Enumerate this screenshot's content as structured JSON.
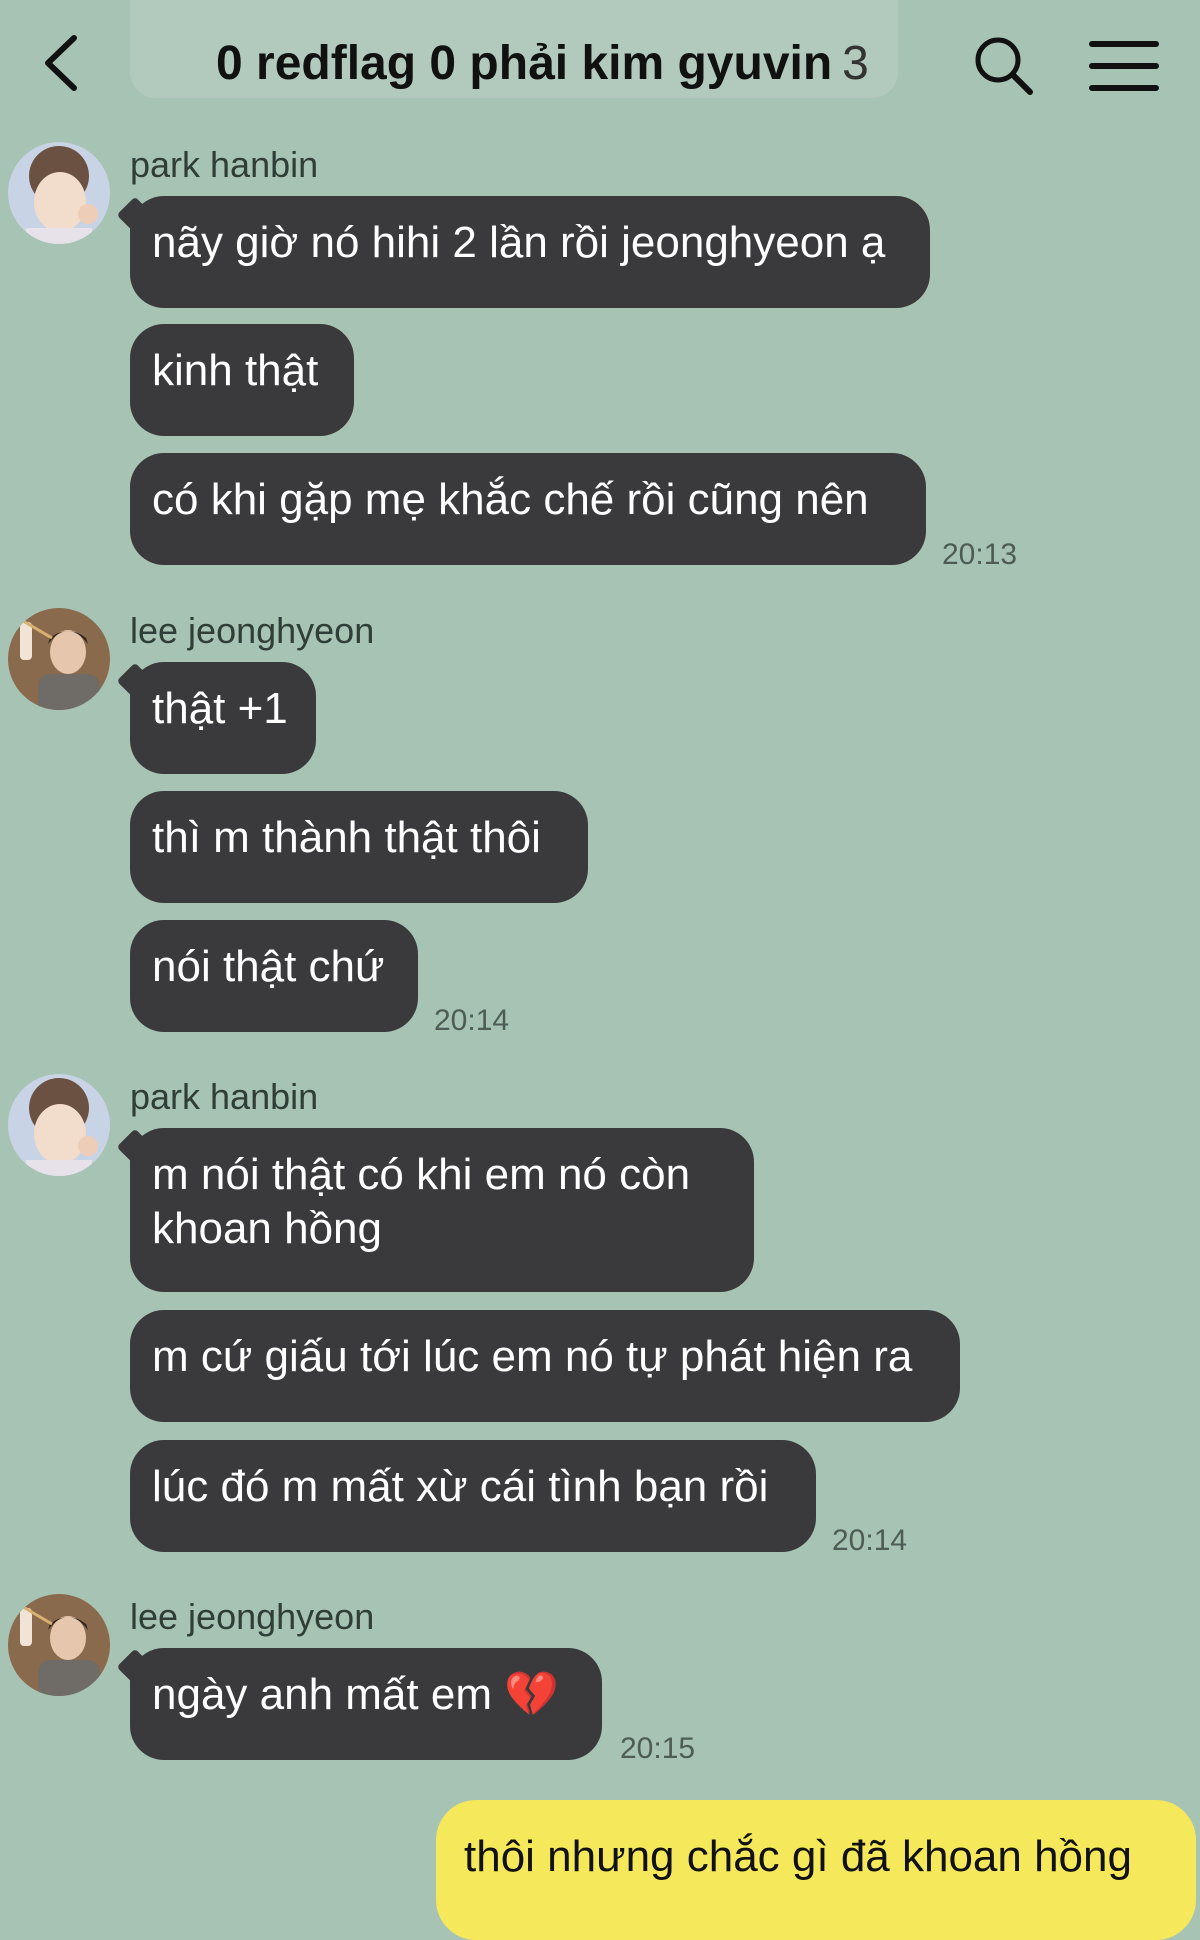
{
  "header": {
    "title": "0 redflag 0 phải kim gyuvin",
    "member_count": "3"
  },
  "messages": [
    {
      "sender": "park hanbin",
      "bubbles": [
        "nãy giờ nó hihi 2 lần rồi jeonghyeon ạ",
        "kinh thật",
        "có khi gặp mẹ khắc chế rồi cũng nên"
      ],
      "time": "20:13"
    },
    {
      "sender": "lee jeonghyeon",
      "bubbles": [
        "thật +1",
        "thì m thành thật thôi",
        "nói thật chứ"
      ],
      "time": "20:14"
    },
    {
      "sender": "park hanbin",
      "bubbles": [
        "m nói thật có khi em nó còn khoan hồng",
        "m cứ giấu tới lúc em nó tự phát hiện ra",
        "lúc đó m mất xừ cái tình bạn rồi"
      ],
      "time": "20:14"
    },
    {
      "sender": "lee jeonghyeon",
      "bubbles": [
        "ngày anh mất em 💔"
      ],
      "time": "20:15"
    }
  ],
  "my_message": "thôi nhưng chắc gì đã khoan hồng",
  "colors": {
    "background": "#a7c3b4",
    "bubble_dark": "#3a3a3c",
    "bubble_mine": "#f5e95b"
  }
}
